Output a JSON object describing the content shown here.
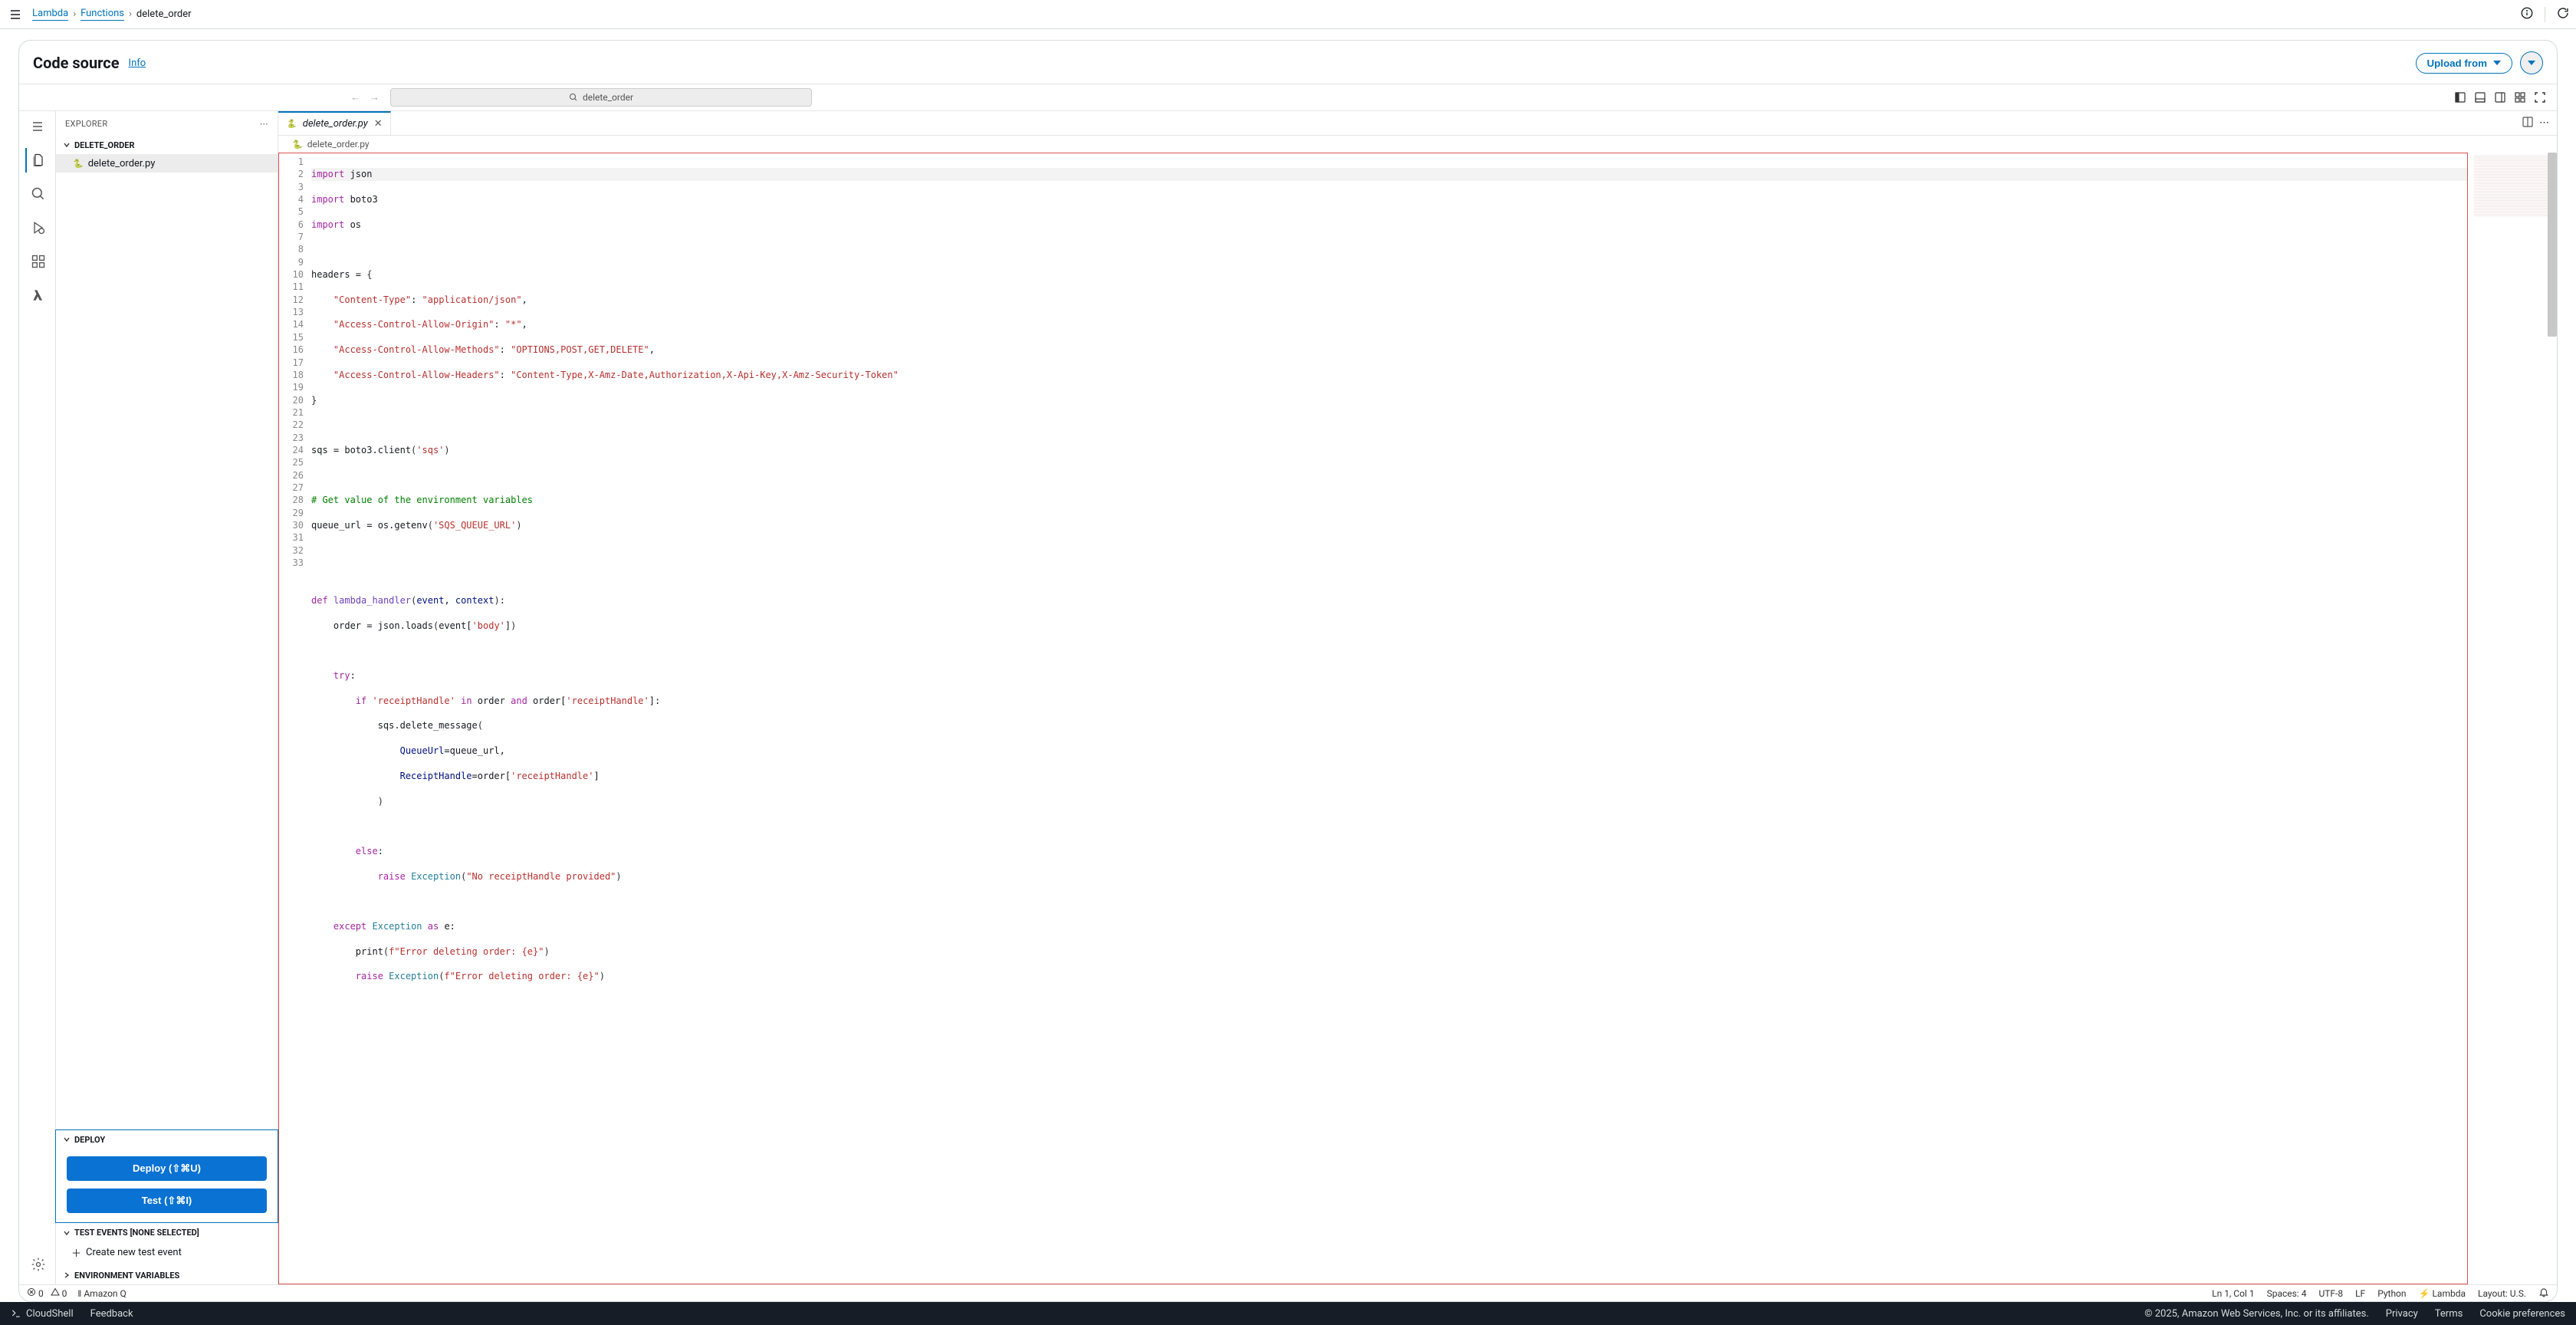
{
  "breadcrumb": {
    "service": "Lambda",
    "section": "Functions",
    "current": "delete_order"
  },
  "panel": {
    "title": "Code source",
    "info": "Info",
    "upload": "Upload from"
  },
  "search_label": "delete_order",
  "explorer": {
    "title": "EXPLORER",
    "root": "DELETE_ORDER",
    "file": "delete_order.py",
    "deploy_section": "DEPLOY",
    "deploy_btn": "Deploy (⇧⌘U)",
    "test_btn": "Test (⇧⌘I)",
    "test_events": "TEST EVENTS [NONE SELECTED]",
    "create_event": "Create new test event",
    "env_vars": "ENVIRONMENT VARIABLES"
  },
  "tab": {
    "name": "delete_order.py",
    "breadcrumb": "delete_order.py"
  },
  "code": {
    "lines": 33
  },
  "status": {
    "errors": "0",
    "warnings": "0",
    "amazon_q": "Amazon Q",
    "cursor": "Ln 1, Col 1",
    "spaces": "Spaces: 4",
    "encoding": "UTF-8",
    "eol": "LF",
    "lang": "Python",
    "lambda": "Lambda",
    "layout": "Layout: U.S."
  },
  "footer": {
    "cloudshell": "CloudShell",
    "feedback": "Feedback",
    "copyright": "© 2025, Amazon Web Services, Inc. or its affiliates.",
    "privacy": "Privacy",
    "terms": "Terms",
    "cookie": "Cookie preferences"
  }
}
